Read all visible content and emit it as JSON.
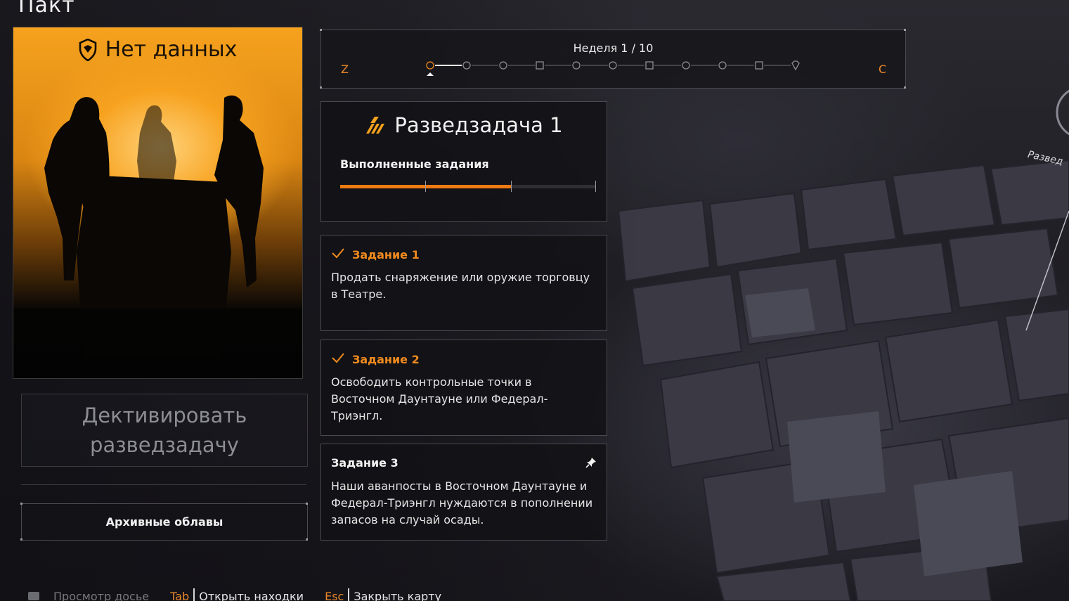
{
  "screen_title": "Пакт",
  "portrait": {
    "header": "Нет данных",
    "icon": "faction-shield-icon"
  },
  "deactivate": {
    "line1": "Дективировать",
    "line2": "разведзадачу"
  },
  "archive_button": "Архивные облавы",
  "week": {
    "label": "Неделя 1 / 10",
    "key_prev": "Z",
    "key_next": "C",
    "current_week": 1,
    "total_weeks": 10,
    "nodes": [
      "circle",
      "circle",
      "circle",
      "square",
      "circle",
      "circle",
      "square",
      "circle",
      "circle",
      "square",
      "diamond"
    ]
  },
  "bounty": {
    "title": "Разведзадача 1",
    "icon": "rank-chevrons-icon",
    "completed_label": "Выполненные задания",
    "progress_fraction": 0.667,
    "accent_color": "#f07a12"
  },
  "tasks": [
    {
      "title": "Задание 1",
      "completed": true,
      "description": "Продать снаряжение или оружие торговцу в Театре."
    },
    {
      "title": "Задание 2",
      "completed": true,
      "description": "Освободить контрольные точки в Восточном Даунтауне или Федерал-Триэнгл."
    },
    {
      "title": "Задание 3",
      "completed": false,
      "pinned": true,
      "description": "Наши аванпосты в Восточном Даунтауне и Федерал-Триэнгл нуждаются в пополнении запасов на случай осады."
    }
  ],
  "map_label": "Развед",
  "hints": [
    {
      "key": "",
      "text": "Просмотр досье"
    },
    {
      "key": "Tab",
      "text": "Открыть находки"
    },
    {
      "key": "Esc",
      "text": "Закрыть карту"
    }
  ]
}
